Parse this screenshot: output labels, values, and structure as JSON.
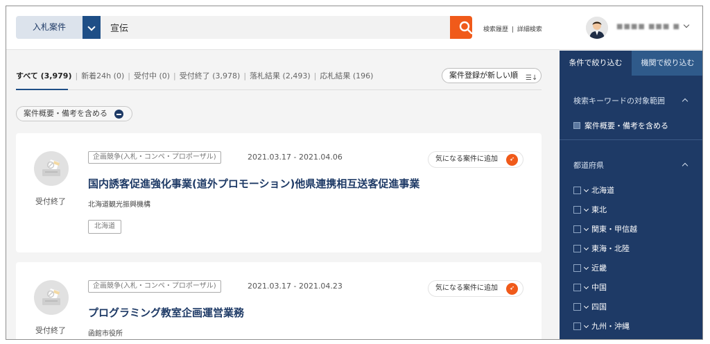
{
  "header": {
    "category_label": "入札案件",
    "search_value": "宣伝",
    "history_link": "検索履歴",
    "link_sep": "|",
    "detail_link": "詳細検索",
    "user_name": "■■■■ ■■■ ■"
  },
  "tabs": [
    {
      "label": "すべて (3,979)"
    },
    {
      "label": "新着24h (0)"
    },
    {
      "label": "受付中 (0)"
    },
    {
      "label": "受付終了 (3,978)"
    },
    {
      "label": "落札結果 (2,493)"
    },
    {
      "label": "応札結果 (196)"
    }
  ],
  "tab_sep": "|",
  "sort": {
    "label": "案件登録が新しい順",
    "icon": "sort-desc-icon"
  },
  "include_chip": {
    "label": "案件概要・備考を含める",
    "icon": "minus-circle-icon"
  },
  "cards": [
    {
      "status": "受付終了",
      "type": "企画競争(入札・コンペ・プロポーザル)",
      "dates": "2021.03.17 - 2021.04.06",
      "fav_label": "気になる案件に追加",
      "title": "国内誘客促進強化事業(道外プロモーション)他県連携相互送客促進事業",
      "org": "北海道観光振興機構",
      "pref": "北海道"
    },
    {
      "status": "受付終了",
      "type": "企画競争(入札・コンペ・プロポーザル)",
      "dates": "2021.03.17 - 2021.04.23",
      "fav_label": "気になる案件に追加",
      "title": "プログラミング教室企画運営業務",
      "org": "函館市役所"
    }
  ],
  "sidebar": {
    "tab_conditions": "条件で絞り込む",
    "tab_agency": "機関で絞り込む",
    "keyword_section": "検索キーワードの対象範囲",
    "keyword_option": "案件概要・備考を含める",
    "pref_section": "都道府県",
    "prefs": [
      "北海道",
      "東北",
      "関東・甲信越",
      "東海・北陸",
      "近畿",
      "中国",
      "四国",
      "九州・沖縄"
    ]
  },
  "colors": {
    "navy": "#1e3a66",
    "orange": "#f05a1a",
    "blue_toggle": "#1e4e86"
  }
}
